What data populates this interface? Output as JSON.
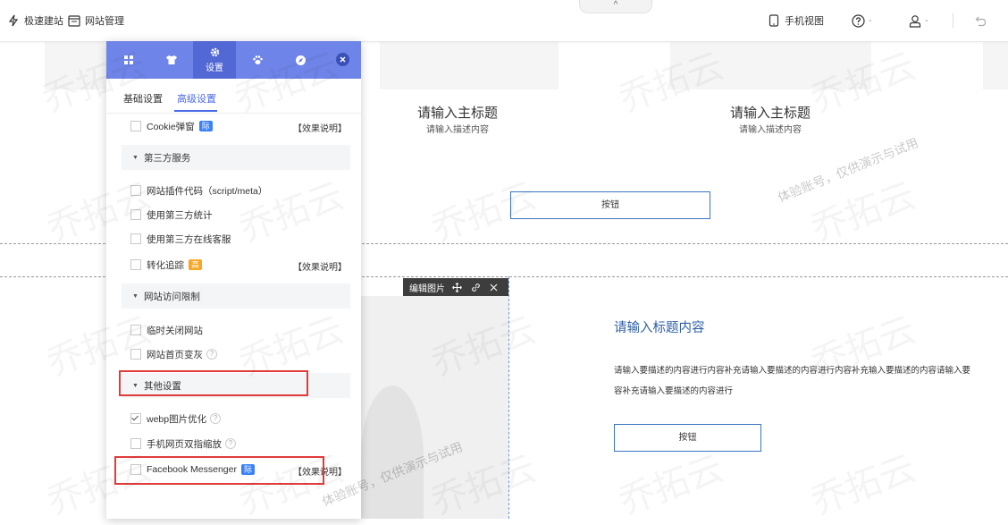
{
  "topbar": {
    "site_builder_label": "极速建站",
    "site_manage_label": "网站管理",
    "mobile_view_label": "手机视图",
    "collapse_arrow": "^",
    "help_caret": "-",
    "user_caret": "-"
  },
  "panel": {
    "tabs": [
      {
        "icon": "grid-icon",
        "label": ""
      },
      {
        "icon": "shirt-icon",
        "label": ""
      },
      {
        "icon": "gear-icon",
        "label": "设置"
      },
      {
        "icon": "paw-icon",
        "label": ""
      },
      {
        "icon": "compass-icon",
        "label": ""
      }
    ],
    "subtabs": {
      "basic": "基础设置",
      "advanced": "高级设置"
    },
    "rows": {
      "cookie": "Cookie弹窗",
      "cookie_badge": "际",
      "effect": "【效果说明】",
      "third_party_section": "第三方服务",
      "plugin_code": "网站插件代码（script/meta）",
      "third_stats": "使用第三方统计",
      "third_service": "使用第三方在线客服",
      "conversion": "转化追踪",
      "conversion_badge": "高",
      "access_section": "网站访问限制",
      "close_site": "临时关闭网站",
      "gray_home": "网站首页变灰",
      "other_section": "其他设置",
      "webp": "webp图片优化",
      "pinch_zoom": "手机网页双指缩放",
      "messenger": "Facebook Messenger",
      "messenger_badge": "际",
      "qmark": "?"
    },
    "checked": {
      "webp": true
    }
  },
  "canvas": {
    "title_main": "请输入主标题",
    "desc_main": "请输入描述内容",
    "button_label": "按钮",
    "image_toolbar_label": "编辑图片",
    "section_title": "请输入标题内容",
    "section_body_line1": "请输入要描述的内容进行内容补充请输入要描述的内容进行内容补充输入要描述的内容请输入要",
    "section_body_line2": "容补充请输入要描述的内容进行"
  },
  "watermark": {
    "logo_text": "乔拓云",
    "demo_text": "体验账号，仅供演示与试用"
  },
  "colors": {
    "panel_head": "#6f84e8",
    "accent": "#4a69e8",
    "highlight": "#e23b3b",
    "badge_blue": "#3b82f6",
    "badge_orange": "#f5a623"
  }
}
